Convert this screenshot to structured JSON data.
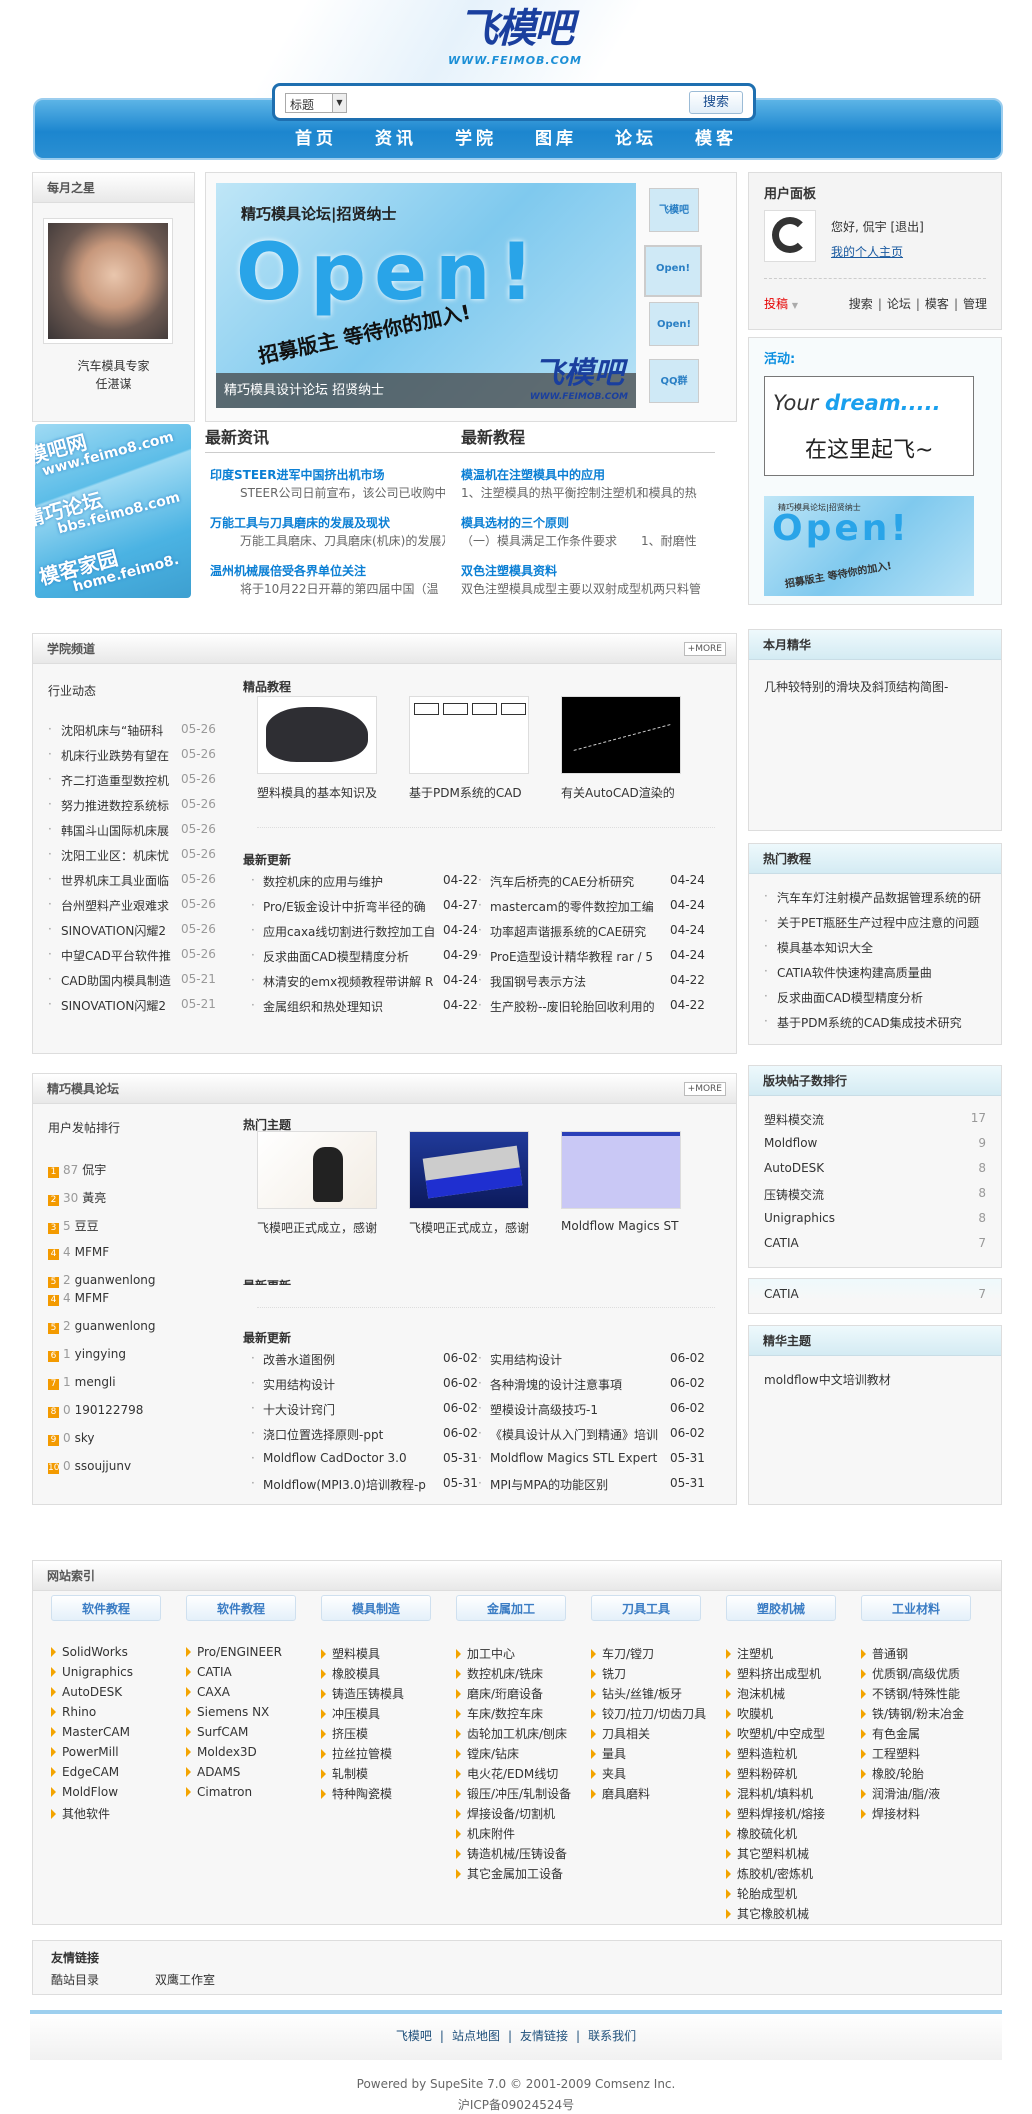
{
  "header": {
    "logo_text": "飞模吧",
    "logo_url": "WWW.FEIMOB.COM"
  },
  "search": {
    "scope": "标题",
    "value": "",
    "button": "搜索"
  },
  "nav": [
    "首页",
    "资讯",
    "学院",
    "图库",
    "论坛",
    "模客"
  ],
  "star": {
    "title": "每月之星",
    "caption1": "汽车模具专家",
    "caption2": "任湛谋"
  },
  "banner": {
    "top_text": "精巧模具论坛|招贤纳士",
    "open": "Open!",
    "slogan": "招募版主  等待你的加入!",
    "caption": "精巧模具设计论坛  招贤纳士",
    "logo_text": "飞模吧",
    "logo_url": "WWW.FEIMOB.COM",
    "thumbs": [
      "飞模吧",
      "Open!",
      "Open!",
      "QQ群"
    ]
  },
  "user_panel": {
    "title": "用户面板",
    "greeting": "您好, 侃宇",
    "logout": "[退出]",
    "homepage": "我的个人主页",
    "contribute": "投稿",
    "links": [
      "搜索",
      "论坛",
      "模客",
      "管理"
    ]
  },
  "activity": {
    "title": "活动:",
    "ad1_line1a": "Your ",
    "ad1_line1b": "dream.....",
    "ad1_line2": "在这里起飞~",
    "ad2_top": "精巧模具论坛|招贤纳士",
    "ad2_open": "Open!",
    "ad2_slogan": "招募版主 等待你的加入!"
  },
  "side_ad": {
    "lines": [
      "飞模吧网",
      "www.feimo8.com",
      "精巧论坛",
      "bbs.feimo8.com",
      "模客家园",
      "home.feimo8."
    ]
  },
  "latest": {
    "news_title": "最新资讯",
    "tut_title": "最新教程",
    "news": [
      {
        "title": "印度STEER进军中国挤出机市场",
        "summary": "STEER公司日前宣布，该公司已收购中国"
      },
      {
        "title": "万能工具与刀具磨床的发展及现状",
        "summary": "万能工具磨床、刀具磨床(机床)的发展及"
      },
      {
        "title": "温州机械展倍受各界单位关注",
        "summary": "将于10月22日开幕的第四届中国（温"
      }
    ],
    "tutorials": [
      {
        "title": "模温机在注塑模具中的应用",
        "summary": "1、注塑模具的热平衡控制注塑机和模具的热"
      },
      {
        "title": "模具选材的三个原则",
        "summary": "（一）模具满足工作条件要求　　1、耐磨性"
      },
      {
        "title": "双色注塑模具资料",
        "summary": "双色注塑模具成型主要以双射成型机两只料管"
      }
    ]
  },
  "academy": {
    "title": "学院频道",
    "more": "+MORE",
    "industry_title": "行业动态",
    "industry": [
      {
        "t": "沈阳机床与“轴研科",
        "d": "05-26"
      },
      {
        "t": "机床行业跌势有望在",
        "d": "05-26"
      },
      {
        "t": "齐二打造重型数控机",
        "d": "05-26"
      },
      {
        "t": "努力推进数控系统标",
        "d": "05-26"
      },
      {
        "t": "韩国斗山国际机床展",
        "d": "05-26"
      },
      {
        "t": "沈阳工业区：机床忧",
        "d": "05-26"
      },
      {
        "t": "世界机床工具业面临",
        "d": "05-26"
      },
      {
        "t": "台州塑料产业艰难求",
        "d": "05-26"
      },
      {
        "t": "SINOVATION闪耀2",
        "d": "05-26"
      },
      {
        "t": "中望CAD平台软件推",
        "d": "05-26"
      },
      {
        "t": "CAD助国内模具制造",
        "d": "05-21"
      },
      {
        "t": "SINOVATION闪耀2",
        "d": "05-21"
      }
    ],
    "featured_title": "精品教程",
    "featured": [
      "塑料模具的基本知识及",
      "基于PDM系统的CAD",
      "有关AutoCAD渲染的"
    ],
    "updates_title": "最新更新",
    "updates": [
      {
        "t": "数控机床的应用与维护",
        "d": "04-22"
      },
      {
        "t": "汽车后桥壳的CAE分析研究",
        "d": "04-24"
      },
      {
        "t": "Pro/E钣金设计中折弯半径的确",
        "d": "04-27"
      },
      {
        "t": "mastercam的零件数控加工编",
        "d": "04-24"
      },
      {
        "t": "应用caxa线切割进行数控加工自",
        "d": "04-24"
      },
      {
        "t": "功率超声谐振系统的CAE研究",
        "d": "04-24"
      },
      {
        "t": "反求曲面CAD模型精度分析",
        "d": "04-29"
      },
      {
        "t": "ProE造型设计精华教程  rar / 5",
        "d": "04-24"
      },
      {
        "t": "林清安的emx视频教程带讲解  R",
        "d": "04-24"
      },
      {
        "t": "我国钢号表示方法",
        "d": "04-22"
      },
      {
        "t": "金属组织和热处理知识",
        "d": "04-22"
      },
      {
        "t": "生产胶粉--废旧轮胎回收利用的",
        "d": "04-22"
      }
    ]
  },
  "month_best": {
    "title": "本月精华",
    "items": [
      "几种较特别的滑块及斜顶结构简图-"
    ]
  },
  "hot_tutorials": {
    "title": "热门教程",
    "items": [
      "汽车车灯注射模产品数据管理系统的研",
      "关于PET瓶胚生产过程中应注意的问题",
      "模具基本知识大全",
      "CATIA软件快速构建高质量曲",
      "反求曲面CAD模型精度分析",
      "基于PDM系统的CAD集成技术研究"
    ]
  },
  "forum": {
    "title": "精巧模具论坛",
    "more": "+MORE",
    "rank_title": "用户发帖排行",
    "ranking": [
      {
        "n": "1",
        "c": "87",
        "u": "侃宇"
      },
      {
        "n": "2",
        "c": "30",
        "u": "黃亮"
      },
      {
        "n": "3",
        "c": "5",
        "u": "豆豆"
      },
      {
        "n": "4",
        "c": "4",
        "u": "MFMF"
      },
      {
        "n": "5",
        "c": "2",
        "u": "guanwenlong"
      },
      {
        "n": "4",
        "c": "4",
        "u": "MFMF"
      },
      {
        "n": "5",
        "c": "2",
        "u": "guanwenlong"
      },
      {
        "n": "6",
        "c": "1",
        "u": "yingying"
      },
      {
        "n": "7",
        "c": "1",
        "u": "mengli"
      },
      {
        "n": "8",
        "c": "0",
        "u": "190122798"
      },
      {
        "n": "9",
        "c": "0",
        "u": "sky"
      },
      {
        "n": "10",
        "c": "0",
        "u": "ssoujjunv"
      }
    ],
    "hot_title": "热门主题",
    "hot": [
      "飞模吧正式成立，感谢",
      "飞模吧正式成立，感谢",
      "Moldflow Magics ST"
    ],
    "ghost_title": "最新更新",
    "updates_title": "最新更新",
    "updates": [
      {
        "t": "改善水道图例",
        "d": "06-02"
      },
      {
        "t": "实用结构设计",
        "d": "06-02"
      },
      {
        "t": "实用结构设计",
        "d": "06-02"
      },
      {
        "t": "各种滑塊的设计注意事項",
        "d": "06-02"
      },
      {
        "t": "十大设计窍门",
        "d": "06-02"
      },
      {
        "t": "塑模设计高级技巧-1",
        "d": "06-02"
      },
      {
        "t": "浇口位置选择原则-ppt",
        "d": "06-02"
      },
      {
        "t": "《模具设计从入门到精通》培训",
        "d": "06-02"
      },
      {
        "t": "Moldflow CadDoctor 3.0",
        "d": "05-31"
      },
      {
        "t": "Moldflow Magics STL Expert",
        "d": "05-31"
      },
      {
        "t": "Moldflow(MPI3.0)培训教程-p",
        "d": "05-31"
      },
      {
        "t": "MPI与MPA的功能区别",
        "d": "05-31"
      }
    ]
  },
  "board_rank": {
    "title": "版块帖子数排行",
    "items": [
      {
        "n": "塑料模交流",
        "c": "17"
      },
      {
        "n": "Moldflow",
        "c": "9"
      },
      {
        "n": "AutoDESK",
        "c": "8"
      },
      {
        "n": "压铸模交流",
        "c": "8"
      },
      {
        "n": "Unigraphics",
        "c": "8"
      },
      {
        "n": "CATIA",
        "c": "7"
      }
    ],
    "extra": {
      "n": "CATIA",
      "c": "7"
    }
  },
  "elite": {
    "title": "精华主题",
    "items": [
      "moldflow中文培训教材"
    ]
  },
  "site_index": {
    "title": "网站索引",
    "columns": [
      {
        "h": "软件教程",
        "items": [
          "SolidWorks",
          "Unigraphics",
          "AutoDESK",
          "Rhino",
          "MasterCAM",
          "PowerMill",
          "EdgeCAM",
          "MoldFlow",
          "其他软件"
        ]
      },
      {
        "h": "软件教程",
        "items": [
          "Pro/ENGINEER",
          "CATIA",
          "CAXA",
          "Siemens NX",
          "SurfCAM",
          "Moldex3D",
          "ADAMS",
          "Cimatron"
        ]
      },
      {
        "h": "模具制造",
        "items": [
          "塑料模具",
          "橡胶模具",
          "铸造压铸模具",
          "冲压模具",
          "挤压模",
          "拉丝拉管模",
          "轧制模",
          "特种陶瓷模"
        ]
      },
      {
        "h": "金属加工",
        "items": [
          "加工中心",
          "数控机床/铣床",
          "磨床/珩磨设备",
          "车床/数控车床",
          "齿轮加工机床/刨床",
          "镗床/钻床",
          "电火花/EDM线切",
          "锻压/冲压/轧制设备",
          "焊接设备/切割机",
          "机床附件",
          "铸造机械/压铸设备",
          "其它金属加工设备"
        ]
      },
      {
        "h": "刀具工具",
        "items": [
          "车刀/镗刀",
          "铣刀",
          "钻头/丝锥/板牙",
          "铰刀/拉刀/切齿刀具",
          "刀具相关",
          "量具",
          "夹具",
          "磨具磨料"
        ]
      },
      {
        "h": "塑胶机械",
        "items": [
          "注塑机",
          "塑料挤出成型机",
          "泡沫机械",
          "吹膜机",
          "吹塑机/中空成型",
          "塑料造粒机",
          "塑料粉碎机",
          "混料机/填料机",
          "塑料焊接机/熔接",
          "橡胶硫化机",
          "其它塑料机械",
          "炼胶机/密炼机",
          "轮胎成型机",
          "其它橡胶机械"
        ]
      },
      {
        "h": "工业材料",
        "items": [
          "普通钢",
          "优质钢/高级优质",
          "不锈钢/特殊性能",
          "铁/铸钢/粉末冶金",
          "有色金属",
          "工程塑料",
          "橡胶/轮胎",
          "润滑油/脂/液",
          "焊接材料"
        ]
      }
    ]
  },
  "friend_links": {
    "title": "友情链接",
    "items": [
      "酷站目录",
      "双鹰工作室"
    ]
  },
  "footer": {
    "links": [
      "飞模吧",
      "站点地图",
      "友情链接",
      "联系我们"
    ],
    "powered": "Powered by SupeSite 7.0 © 2001-2009 Comsenz Inc.",
    "icp": "沪ICP备09024524号"
  },
  "colors": {
    "nav_blue": "#1c86cf",
    "link_blue": "#0b7fd4",
    "arrow_orange": "#f3a400",
    "contribute_red": "#e60000"
  }
}
